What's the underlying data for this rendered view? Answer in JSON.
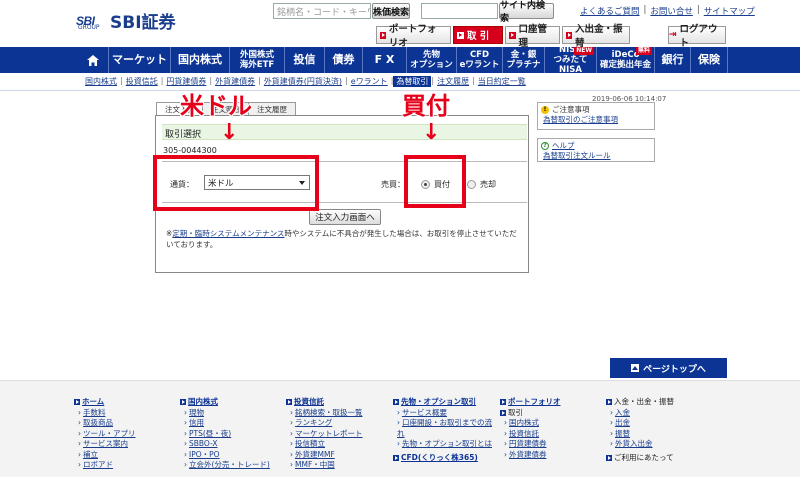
{
  "header": {
    "logo_mark": "SBI",
    "logo_group": "GROUP",
    "logo_text": "SBI証券",
    "search_placeholder": "銘柄名・コード・キーワード",
    "stock_search_btn": "株価検索",
    "site_search_btn": "サイト内検索",
    "links": [
      "よくあるご質問",
      "お問い合せ",
      "サイトマップ"
    ],
    "menu": [
      "ポートフォリオ",
      "取 引",
      "口座管理",
      "入出金・振替"
    ],
    "logout": "ログアウト"
  },
  "mainnav": {
    "items": [
      {
        "label": "マーケット"
      },
      {
        "label": "国内株式"
      },
      {
        "label": "外国株式",
        "label2": "海外ETF"
      },
      {
        "label": "投信"
      },
      {
        "label": "債券"
      },
      {
        "label": "F X"
      },
      {
        "label": "先物",
        "label2": "オプション"
      },
      {
        "label": "CFD",
        "label2": "eワラント"
      },
      {
        "label": "金・銀",
        "label2": "プラチナ"
      },
      {
        "label": "NISA",
        "label2": "つみたてNISA",
        "badge": "NEW"
      },
      {
        "label": "iDeCo",
        "label2": "確定拠出年金",
        "badge": "無料"
      },
      {
        "label": "銀行"
      },
      {
        "label": "保険"
      }
    ]
  },
  "subnav": {
    "items": [
      "国内株式",
      "投資信託",
      "円貨建債券",
      "外貨建債券",
      "外貨建債券(円貨決済)",
      "eワラント",
      "為替取引",
      "注文履歴",
      "当日約定一覧"
    ],
    "active_index": 6
  },
  "content": {
    "datetime": "2019-06-06 10:14:07",
    "tabs": [
      "注文入力",
      "注文照会",
      "注文履歴"
    ],
    "section_title": "取引選択",
    "account": "305-0044300",
    "currency_label": "通貨：",
    "currency_value": "米ドル",
    "side_label": "売買：",
    "buy": "買付",
    "sell": "売却",
    "entry_button": "注文入力画面へ",
    "notice_prefix": "※",
    "notice_link": "定期・臨時システムメンテナンス",
    "notice_text": "時やシステムに不具合が発生した場合は、お取引を停止させていただいております。"
  },
  "annotations": {
    "left_label": "米ドル",
    "right_label": "買付",
    "arrow": "↓",
    "color": "#e6001a"
  },
  "sidebar": {
    "notice_title": "ご注意事項",
    "notice_link": "為替取引のご注意事項",
    "help_title": "ヘルプ",
    "help_link": "為替取引注文ルール"
  },
  "pagetop": "ページトップへ",
  "footer": {
    "cols": [
      {
        "title": "ホーム",
        "items": [
          "手数料",
          "取扱商品",
          "ツール・アプリ",
          "サービス案内",
          "補立",
          "ロボアド"
        ]
      },
      {
        "title": "国内株式",
        "items": [
          "現物",
          "信用",
          "PTS(昼・夜)",
          "SBBO-X",
          "IPO・PO",
          "立会外(分売・トレード)"
        ]
      },
      {
        "title": "投資信託",
        "items": [
          "銘柄検索・取扱一覧",
          "ランキング",
          "マーケットレポート",
          "投信積立",
          "外貨建MMF",
          "MMF・中国"
        ]
      },
      {
        "title": "先物・オプション取引",
        "items": [
          "サービス概要",
          "口座開設・お取引までの流れ",
          "先物・オプション取引とは"
        ],
        "title2": "CFD(くりっく株365)"
      },
      {
        "title": "ポートフォリオ",
        "sub": "取引",
        "items": [
          "国内株式",
          "投資信託",
          "円貨建債券",
          "外貨建債券"
        ]
      },
      {
        "title": "入金・出金・振替",
        "items": [
          "入金",
          "出金",
          "振替",
          "外貨入出金"
        ],
        "title2": "ご利用にあたって"
      }
    ]
  },
  "colors": {
    "brand_blue": "#0c3494",
    "trade_red": "#d6001c",
    "annotation_red": "#e6001a",
    "panel_green": "#eaf6e4"
  }
}
